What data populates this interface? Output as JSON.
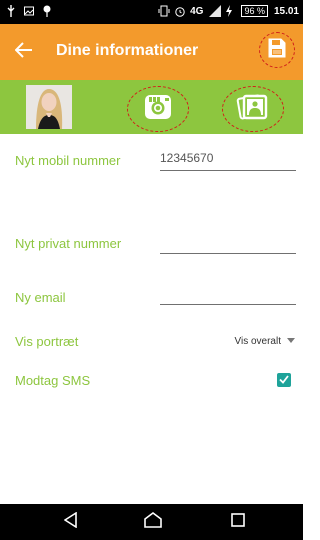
{
  "status": {
    "network": "4G",
    "battery_percent": "96 %",
    "time": "15.01"
  },
  "appbar": {
    "title": "Dine informationer"
  },
  "form": {
    "mobile_label": "Nyt mobil nummer",
    "mobile_value": "12345670",
    "private_label": "Nyt privat nummer",
    "private_value": "",
    "email_label": "Ny email",
    "email_value": "",
    "portrait_label": "Vis portræt",
    "portrait_value": "Vis overalt",
    "sms_label": "Modtag SMS",
    "sms_checked": true
  },
  "colors": {
    "appbar": "#f39a2c",
    "media_band": "#8dc63f",
    "label_green": "#8dc63f",
    "checkbox": "#1ea39a",
    "highlight_circle": "#d0201a"
  },
  "icons": {
    "back": "arrow-left-icon",
    "save": "save-icon",
    "camera": "camera-icon",
    "gallery": "gallery-icon"
  }
}
